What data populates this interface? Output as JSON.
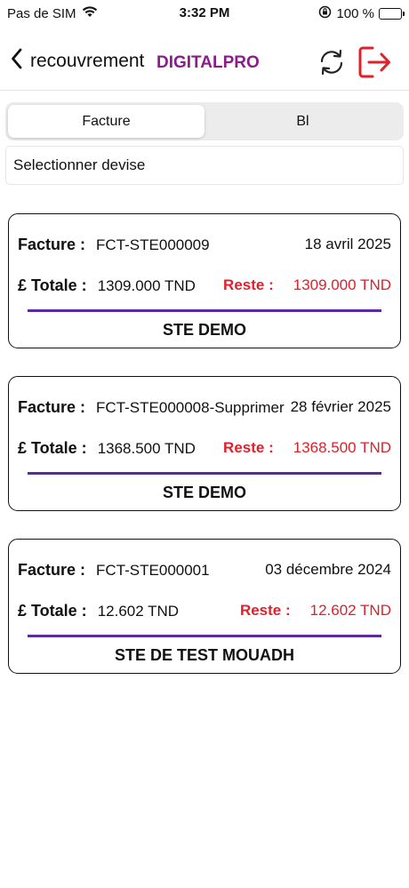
{
  "status_bar": {
    "carrier": "Pas de SIM",
    "time": "3:32 PM",
    "battery": "100 %",
    "battery_level": 1.0,
    "icons": [
      "wifi-icon",
      "orientation-lock-icon",
      "battery-charging-icon"
    ]
  },
  "nav": {
    "back_label": "recouvrement",
    "brand": "DIGITALPRO",
    "brand_color": "#8a1d8a",
    "icons": [
      "chevron-left-icon",
      "refresh-icon",
      "logout-icon"
    ]
  },
  "tabs": [
    {
      "label": "Facture",
      "active": true
    },
    {
      "label": "Bl",
      "active": false
    }
  ],
  "currency_select": {
    "placeholder": "Selectionner devise"
  },
  "labels": {
    "facture": "Facture :",
    "totale": "£ Totale :",
    "reste": "Reste :"
  },
  "colors": {
    "reste": "#e0202a",
    "divider": "#5b2aa0"
  },
  "invoices": [
    {
      "number": "FCT-STE000009",
      "date": "18 avril 2025",
      "total": "1309.000 TND",
      "reste": "1309.000 TND",
      "client": "STE DEMO"
    },
    {
      "number": "FCT-STE000008-Supprimer",
      "date": "28 février 2025",
      "total": "1368.500 TND",
      "reste": "1368.500 TND",
      "client": "STE DEMO"
    },
    {
      "number": "FCT-STE000001",
      "date": "03 décembre 2024",
      "total": "12.602 TND",
      "reste": "12.602 TND",
      "client": "STE DE TEST MOUADH"
    }
  ]
}
